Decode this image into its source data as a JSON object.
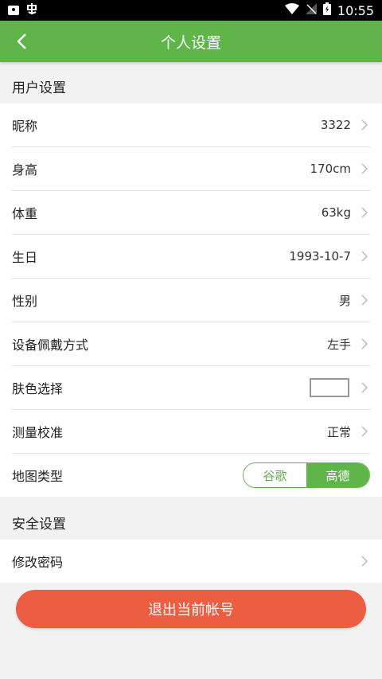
{
  "statusbar": {
    "time": "10:55"
  },
  "header": {
    "title": "个人设置"
  },
  "sections": {
    "user": {
      "title": "用户设置",
      "nickname": {
        "label": "昵称",
        "value": "3322"
      },
      "height": {
        "label": "身高",
        "value": "170cm"
      },
      "weight": {
        "label": "体重",
        "value": "63kg"
      },
      "birthday": {
        "label": "生日",
        "value": "1993-10-7"
      },
      "gender": {
        "label": "性别",
        "value": "男"
      },
      "wear_mode": {
        "label": "设备佩戴方式",
        "value": "左手"
      },
      "skin_color": {
        "label": "肤色选择",
        "swatch_color": "#ffffff"
      },
      "calibration": {
        "label": "测量校准",
        "value": "正常"
      },
      "map_type": {
        "label": "地图类型",
        "options": [
          "谷歌",
          "高德"
        ],
        "selected": "高德"
      }
    },
    "security": {
      "title": "安全设置",
      "change_password": {
        "label": "修改密码"
      }
    }
  },
  "logout_button": {
    "label": "退出当前帐号"
  },
  "colors": {
    "primary": "#5fb54a",
    "danger": "#ec5e42"
  }
}
